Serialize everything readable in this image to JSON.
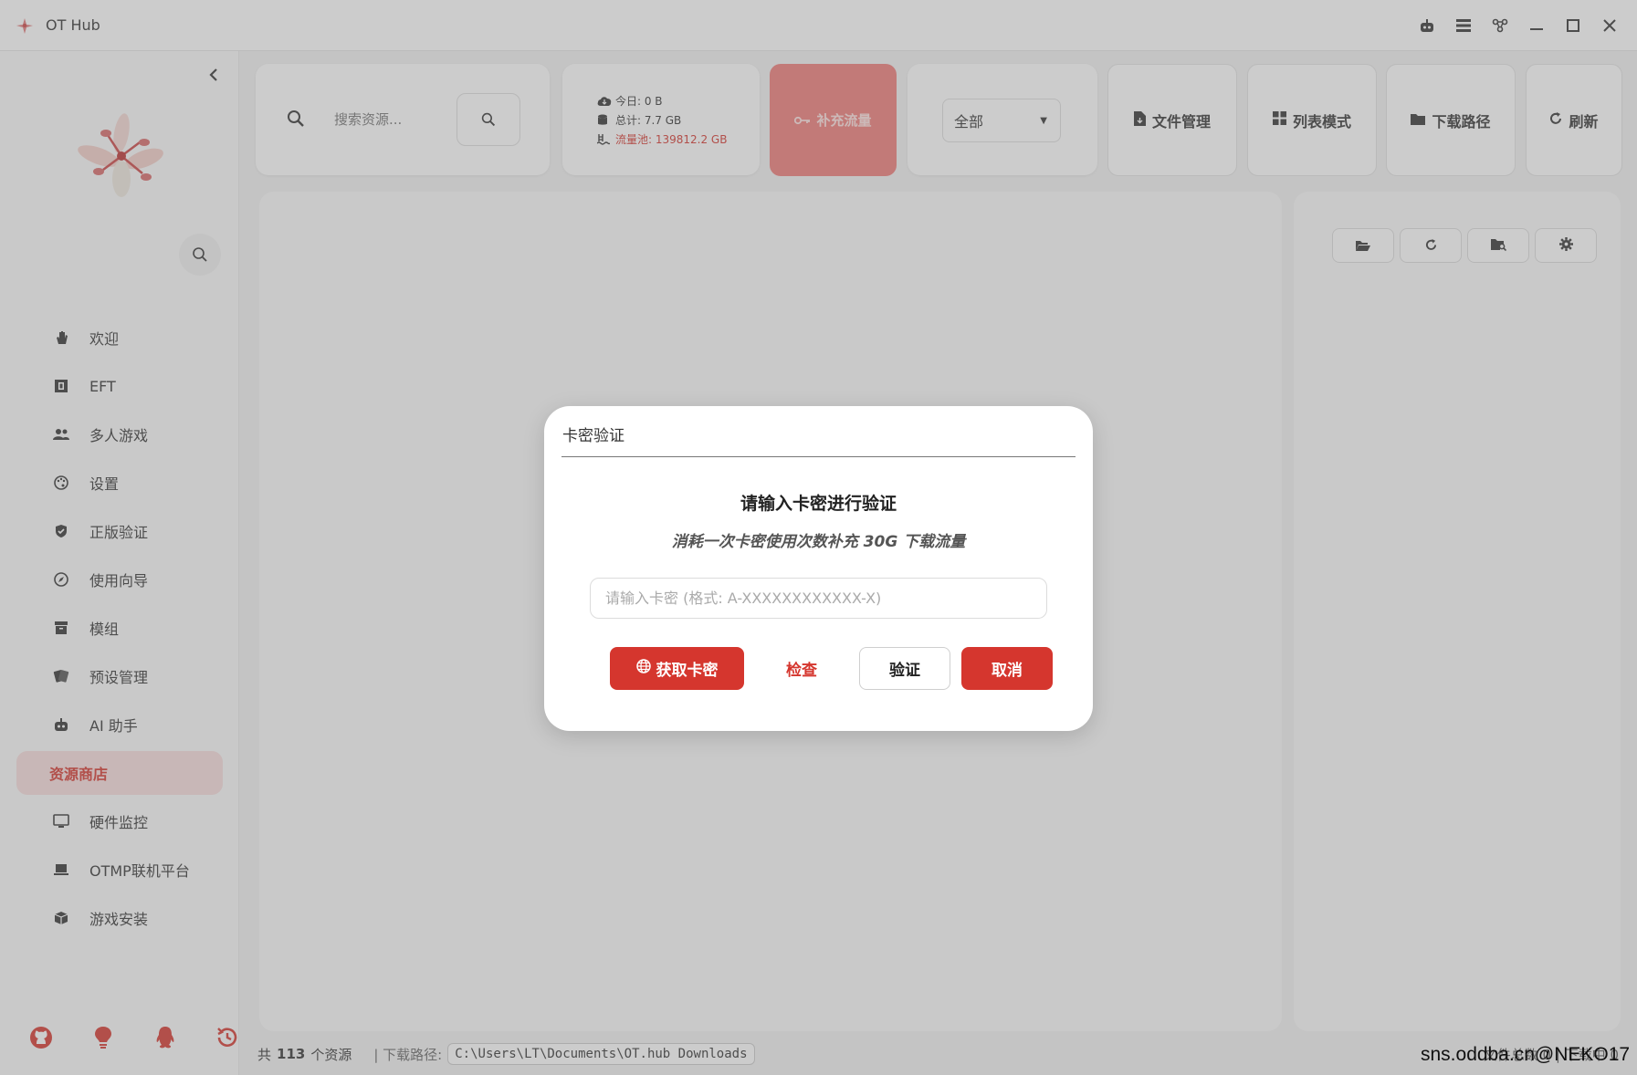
{
  "window": {
    "title": "OT Hub"
  },
  "sidebar": {
    "items": [
      {
        "label": "欢迎",
        "icon": "hand-icon"
      },
      {
        "label": "EFT",
        "icon": "cube-icon"
      },
      {
        "label": "多人游戏",
        "icon": "users-icon"
      },
      {
        "label": "设置",
        "icon": "palette-icon"
      },
      {
        "label": "正版验证",
        "icon": "shield-icon"
      },
      {
        "label": "使用向导",
        "icon": "compass-icon"
      },
      {
        "label": "模组",
        "icon": "archive-icon"
      },
      {
        "label": "预设管理",
        "icon": "cards-icon"
      },
      {
        "label": "AI 助手",
        "icon": "robot-icon"
      },
      {
        "label": "资源商店",
        "icon": "",
        "active": true
      },
      {
        "label": "硬件监控",
        "icon": "desktop-icon"
      },
      {
        "label": "OTMP联机平台",
        "icon": "laptop-icon"
      },
      {
        "label": "游戏安装",
        "icon": "box-icon"
      }
    ]
  },
  "toolbar": {
    "search_placeholder": "搜索资源...",
    "stats": {
      "today": "今日: 0 B",
      "total": "总计: 7.7 GB",
      "pool": "流量池: 139812.2 GB"
    },
    "refill_label": "补充流量",
    "filter_value": "全部",
    "file_manage_label": "文件管理",
    "list_mode_label": "列表模式",
    "download_path_label": "下载路径",
    "refresh_label": "刷新"
  },
  "statusbar": {
    "prefix": "共",
    "count": "113",
    "suffix": "个资源",
    "path_label": "| 下载路径:",
    "path_value": "C:\\Users\\LT\\Documents\\OT.hub Downloads",
    "right_text": "文件总数 0 | 下载中 0"
  },
  "dialog": {
    "title": "卡密验证",
    "heading": "请输入卡密进行验证",
    "subtitle": "消耗一次卡密使用次数补充 30G 下载流量",
    "input_placeholder": "请输入卡密 (格式: A-XXXXXXXXXXXX-X)",
    "get_key_label": "获取卡密",
    "check_label": "检查",
    "verify_label": "验证",
    "cancel_label": "取消"
  },
  "watermark": "sns.oddba.cn@NEKO17",
  "colors": {
    "accent": "#d5362e",
    "accent_light": "#f8dedd",
    "refill_bg": "#ef7b78"
  }
}
